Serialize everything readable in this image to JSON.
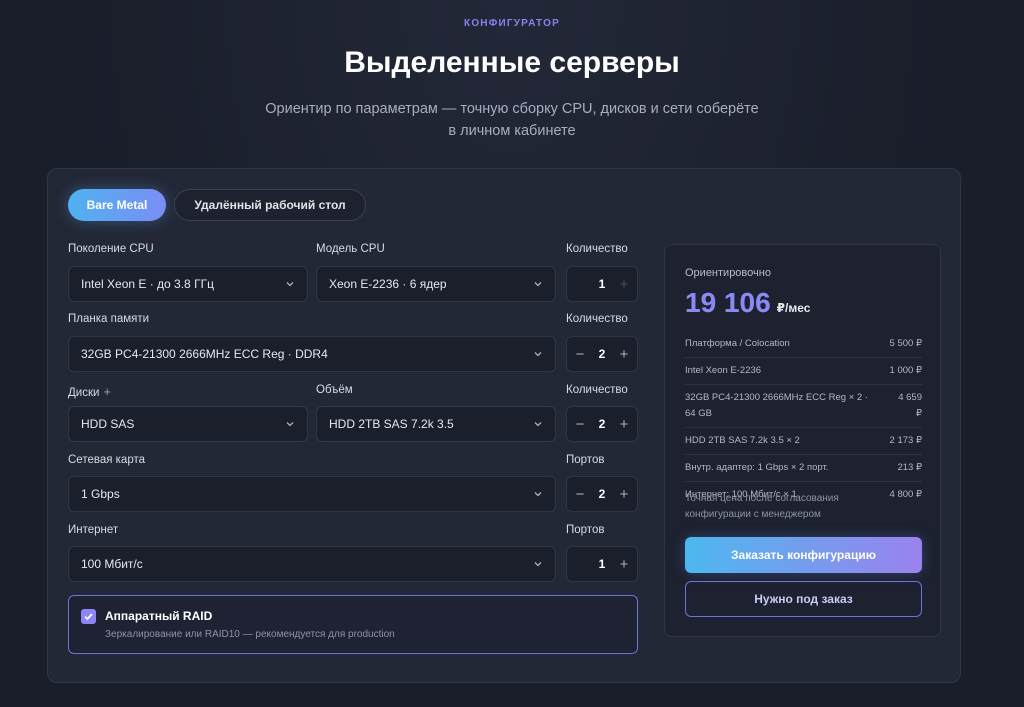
{
  "header": {
    "eyebrow": "КОНФИГУРАТОР",
    "title": "Выделенные серверы",
    "subtitle": "Ориентир по параметрам — точную сборку CPU, дисков и сети соберёте в личном кабинете"
  },
  "tabs": [
    {
      "label": "Bare Metal",
      "active": true
    },
    {
      "label": "Удалённый рабочий стол",
      "active": false
    }
  ],
  "form": {
    "cpu_gen": {
      "label": "Поколение CPU",
      "value": "Intel Xeon E · до 3.8 ГГц"
    },
    "cpu_model": {
      "label": "Модель CPU",
      "value": "Xeon E-2236 · 6 ядер"
    },
    "cpu_qty": {
      "label": "Количество",
      "value": "1"
    },
    "ram": {
      "label": "Планка памяти",
      "value": "32GB PC4-21300 2666MHz ECC Reg · DDR4"
    },
    "ram_qty": {
      "label": "Количество",
      "value": "2"
    },
    "disks": {
      "label": "Диски",
      "value": "HDD SAS"
    },
    "volume": {
      "label": "Объём",
      "value": "HDD 2TB SAS 7.2k 3.5"
    },
    "disk_qty": {
      "label": "Количество",
      "value": "2"
    },
    "nic": {
      "label": "Сетевая карта",
      "value": "1 Gbps"
    },
    "nic_ports": {
      "label": "Портов",
      "value": "2"
    },
    "internet": {
      "label": "Интернет",
      "value": "100 Мбит/с"
    },
    "internet_ports": {
      "label": "Портов",
      "value": "1"
    },
    "raid": {
      "checked": true,
      "title": "Аппаратный RAID",
      "description": "Зеркалирование или RAID10 — рекомендуется для production"
    }
  },
  "summary": {
    "label": "Ориентировочно",
    "price": "19 106",
    "unit": "₽/мес",
    "items": [
      {
        "name": "Платформа / Colocation",
        "amount": "5 500 ₽"
      },
      {
        "name": "Intel Xeon E-2236",
        "amount": "1 000 ₽"
      },
      {
        "name": "32GB PC4-21300 2666MHz ECC Reg × 2 · 64 GB",
        "amount": "4 659 ₽"
      },
      {
        "name": "HDD 2TB SAS 7.2k 3.5 × 2",
        "amount": "2 173 ₽"
      },
      {
        "name": "Внутр. адаптер: 1 Gbps × 2 порт.",
        "amount": "213 ₽"
      },
      {
        "name": "Интернет: 100 Мбит/с × 1",
        "amount": "4 800 ₽"
      }
    ],
    "note": "Точная цена после согласования конфигурации с менеджером",
    "primary_button": "Заказать конфигурацию",
    "secondary_button": "Нужно под заказ"
  },
  "colors": {
    "accent": "#8a86f5",
    "gradient_start": "#4cb8ef",
    "gradient_end": "#9b82ee",
    "background": "#1a1e2b"
  },
  "icons": {
    "chevron": "chevron-down-icon",
    "plus": "plus-icon",
    "minus": "minus-icon",
    "check": "check-icon"
  }
}
